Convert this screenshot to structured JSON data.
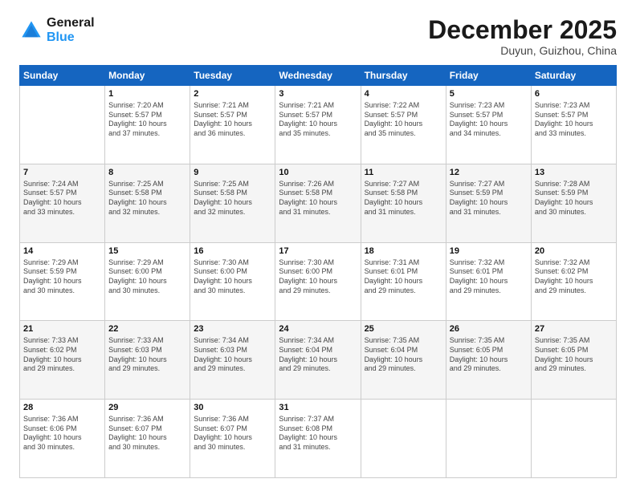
{
  "header": {
    "logo_line1": "General",
    "logo_line2": "Blue",
    "month": "December 2025",
    "location": "Duyun, Guizhou, China"
  },
  "days_of_week": [
    "Sunday",
    "Monday",
    "Tuesday",
    "Wednesday",
    "Thursday",
    "Friday",
    "Saturday"
  ],
  "weeks": [
    [
      {
        "num": "",
        "info": ""
      },
      {
        "num": "1",
        "info": "Sunrise: 7:20 AM\nSunset: 5:57 PM\nDaylight: 10 hours\nand 37 minutes."
      },
      {
        "num": "2",
        "info": "Sunrise: 7:21 AM\nSunset: 5:57 PM\nDaylight: 10 hours\nand 36 minutes."
      },
      {
        "num": "3",
        "info": "Sunrise: 7:21 AM\nSunset: 5:57 PM\nDaylight: 10 hours\nand 35 minutes."
      },
      {
        "num": "4",
        "info": "Sunrise: 7:22 AM\nSunset: 5:57 PM\nDaylight: 10 hours\nand 35 minutes."
      },
      {
        "num": "5",
        "info": "Sunrise: 7:23 AM\nSunset: 5:57 PM\nDaylight: 10 hours\nand 34 minutes."
      },
      {
        "num": "6",
        "info": "Sunrise: 7:23 AM\nSunset: 5:57 PM\nDaylight: 10 hours\nand 33 minutes."
      }
    ],
    [
      {
        "num": "7",
        "info": "Sunrise: 7:24 AM\nSunset: 5:57 PM\nDaylight: 10 hours\nand 33 minutes."
      },
      {
        "num": "8",
        "info": "Sunrise: 7:25 AM\nSunset: 5:58 PM\nDaylight: 10 hours\nand 32 minutes."
      },
      {
        "num": "9",
        "info": "Sunrise: 7:25 AM\nSunset: 5:58 PM\nDaylight: 10 hours\nand 32 minutes."
      },
      {
        "num": "10",
        "info": "Sunrise: 7:26 AM\nSunset: 5:58 PM\nDaylight: 10 hours\nand 31 minutes."
      },
      {
        "num": "11",
        "info": "Sunrise: 7:27 AM\nSunset: 5:58 PM\nDaylight: 10 hours\nand 31 minutes."
      },
      {
        "num": "12",
        "info": "Sunrise: 7:27 AM\nSunset: 5:59 PM\nDaylight: 10 hours\nand 31 minutes."
      },
      {
        "num": "13",
        "info": "Sunrise: 7:28 AM\nSunset: 5:59 PM\nDaylight: 10 hours\nand 30 minutes."
      }
    ],
    [
      {
        "num": "14",
        "info": "Sunrise: 7:29 AM\nSunset: 5:59 PM\nDaylight: 10 hours\nand 30 minutes."
      },
      {
        "num": "15",
        "info": "Sunrise: 7:29 AM\nSunset: 6:00 PM\nDaylight: 10 hours\nand 30 minutes."
      },
      {
        "num": "16",
        "info": "Sunrise: 7:30 AM\nSunset: 6:00 PM\nDaylight: 10 hours\nand 30 minutes."
      },
      {
        "num": "17",
        "info": "Sunrise: 7:30 AM\nSunset: 6:00 PM\nDaylight: 10 hours\nand 29 minutes."
      },
      {
        "num": "18",
        "info": "Sunrise: 7:31 AM\nSunset: 6:01 PM\nDaylight: 10 hours\nand 29 minutes."
      },
      {
        "num": "19",
        "info": "Sunrise: 7:32 AM\nSunset: 6:01 PM\nDaylight: 10 hours\nand 29 minutes."
      },
      {
        "num": "20",
        "info": "Sunrise: 7:32 AM\nSunset: 6:02 PM\nDaylight: 10 hours\nand 29 minutes."
      }
    ],
    [
      {
        "num": "21",
        "info": "Sunrise: 7:33 AM\nSunset: 6:02 PM\nDaylight: 10 hours\nand 29 minutes."
      },
      {
        "num": "22",
        "info": "Sunrise: 7:33 AM\nSunset: 6:03 PM\nDaylight: 10 hours\nand 29 minutes."
      },
      {
        "num": "23",
        "info": "Sunrise: 7:34 AM\nSunset: 6:03 PM\nDaylight: 10 hours\nand 29 minutes."
      },
      {
        "num": "24",
        "info": "Sunrise: 7:34 AM\nSunset: 6:04 PM\nDaylight: 10 hours\nand 29 minutes."
      },
      {
        "num": "25",
        "info": "Sunrise: 7:35 AM\nSunset: 6:04 PM\nDaylight: 10 hours\nand 29 minutes."
      },
      {
        "num": "26",
        "info": "Sunrise: 7:35 AM\nSunset: 6:05 PM\nDaylight: 10 hours\nand 29 minutes."
      },
      {
        "num": "27",
        "info": "Sunrise: 7:35 AM\nSunset: 6:05 PM\nDaylight: 10 hours\nand 29 minutes."
      }
    ],
    [
      {
        "num": "28",
        "info": "Sunrise: 7:36 AM\nSunset: 6:06 PM\nDaylight: 10 hours\nand 30 minutes."
      },
      {
        "num": "29",
        "info": "Sunrise: 7:36 AM\nSunset: 6:07 PM\nDaylight: 10 hours\nand 30 minutes."
      },
      {
        "num": "30",
        "info": "Sunrise: 7:36 AM\nSunset: 6:07 PM\nDaylight: 10 hours\nand 30 minutes."
      },
      {
        "num": "31",
        "info": "Sunrise: 7:37 AM\nSunset: 6:08 PM\nDaylight: 10 hours\nand 31 minutes."
      },
      {
        "num": "",
        "info": ""
      },
      {
        "num": "",
        "info": ""
      },
      {
        "num": "",
        "info": ""
      }
    ]
  ]
}
